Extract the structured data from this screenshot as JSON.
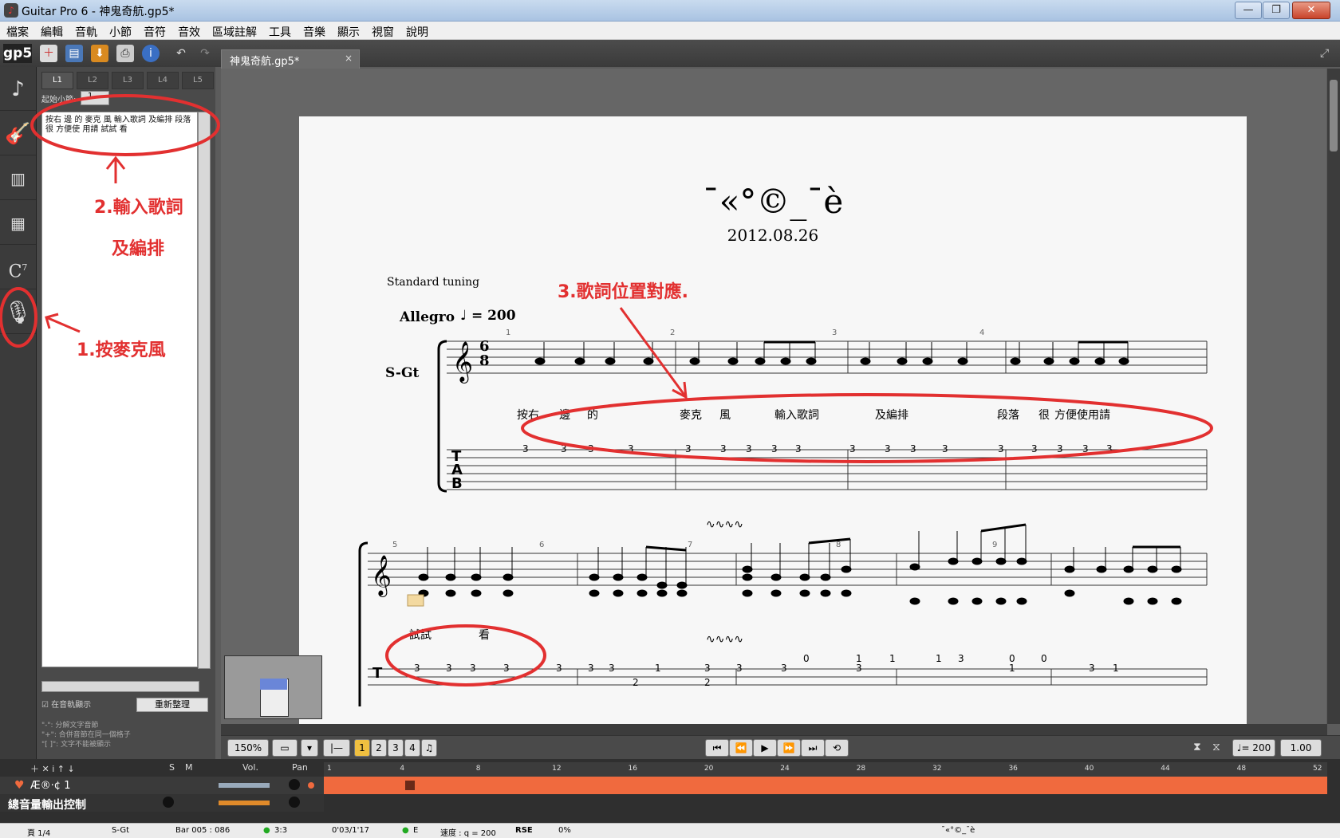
{
  "window": {
    "title": "Guitar Pro 6 - 神鬼奇航.gp5*",
    "min": "—",
    "max": "❐",
    "close": "✕"
  },
  "menu": [
    "檔案",
    "編輯",
    "音軌",
    "小節",
    "音符",
    "音效",
    "區域註解",
    "工具",
    "音樂",
    "顯示",
    "視窗",
    "說明"
  ],
  "toolbar": {
    "logo": "gp5"
  },
  "document_tab": {
    "label": "神鬼奇航.gp5*",
    "close": "×"
  },
  "lyrics_panel": {
    "tabs": [
      "L1",
      "L2",
      "L3",
      "L4",
      "L5"
    ],
    "start_bar_label": "起始小節:",
    "start_bar_value": "1",
    "text": "按右 邊 的  麥克 風  輸入歌詞  及編排  段落 很 方便使 用請 試試 看",
    "show_on_track": "在音軌顯示",
    "reorganize_button": "重新整理",
    "help": [
      "\"-\": 分解文字音節",
      "\"+\": 合併音節在同一個格子",
      "\"[ ]\": 文字不能被顯示"
    ]
  },
  "score": {
    "title": "¯«°©_¯è",
    "subtitle": "2012.08.26",
    "tuning": "Standard tuning",
    "tempo_text": "Allegro",
    "tempo_value": "= 200",
    "track_name": "S-Gt",
    "time_sig_top": "6",
    "time_sig_bottom": "8",
    "bar_numbers_sys1": [
      "1",
      "2",
      "3",
      "4"
    ],
    "bar_numbers_sys2": [
      "5",
      "6",
      "7",
      "8",
      "9"
    ],
    "lyrics_sys1": [
      "按右",
      "邊",
      "的",
      "麥克",
      "風",
      "輸入歌詞",
      "及編排",
      "段落",
      "很",
      "方便使用請"
    ],
    "lyrics_sys2": [
      "試試",
      "看"
    ],
    "tab_letters": [
      "T",
      "A",
      "B"
    ],
    "tab_sys1": [
      "3",
      "3",
      "3",
      "3",
      "3",
      "3",
      "3",
      "3",
      "3",
      "3",
      "3",
      "3",
      "3",
      "3",
      "3",
      "3",
      "3",
      "3",
      "3"
    ],
    "tab_sys2": [
      "3",
      "3",
      "3",
      "3",
      "3",
      "3",
      "3",
      "1",
      "2",
      "3",
      "2",
      "3",
      "3",
      "0",
      "1",
      "3",
      "1",
      "1",
      "3",
      "0",
      "0",
      "1",
      "3",
      "1"
    ]
  },
  "annotations": {
    "step1": "1.按麥克風",
    "step2a": "2.輸入歌詞",
    "step2b": "及編排",
    "step3": "3.歌詞位置對應."
  },
  "transport": {
    "zoom": "150%",
    "voices": [
      "1",
      "2",
      "3",
      "4"
    ],
    "tempo": "= 200",
    "speed": "1.00"
  },
  "tracks": {
    "header_vol": "Vol.",
    "header_pan": "Pan",
    "header_s": "S",
    "header_m": "M",
    "track1_name": "Æ®·¢ 1",
    "master_name": "總音量輸出控制",
    "ruler": [
      "1",
      "4",
      "8",
      "12",
      "16",
      "20",
      "24",
      "28",
      "32",
      "36",
      "40",
      "44",
      "48",
      "52"
    ]
  },
  "status": {
    "page": "頁 1/4",
    "track": "S-Gt",
    "bar": "Bar 005 : 086",
    "sig": "3:3",
    "time": "0'03/1'17",
    "key": "E",
    "tempo": "速度 : q = 200",
    "rse": "RSE",
    "pct": "0%",
    "song": "¯«°©_¯è"
  },
  "colors": {
    "annotation": "#e23030",
    "timeline": "#f06a3e",
    "page": "#f7f7f7"
  }
}
